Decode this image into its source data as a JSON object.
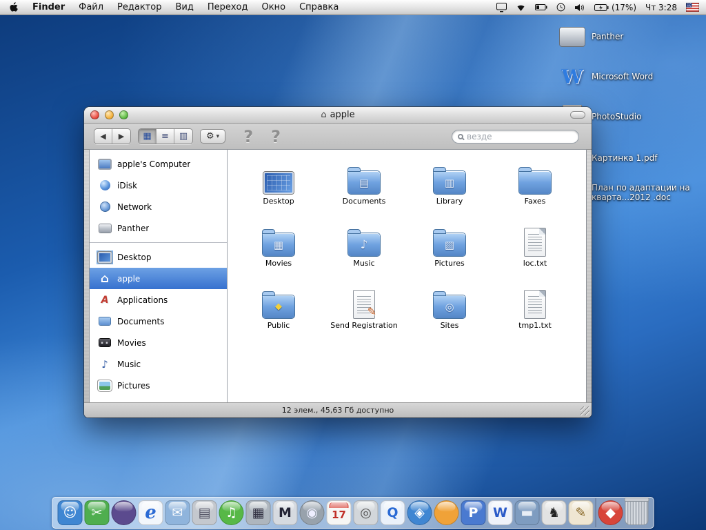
{
  "menubar": {
    "menus": [
      {
        "name": "menu-finder",
        "label": "Finder",
        "cls": "bold"
      },
      {
        "name": "menu-file",
        "label": "Файл"
      },
      {
        "name": "menu-edit",
        "label": "Редактор"
      },
      {
        "name": "menu-view",
        "label": "Вид"
      },
      {
        "name": "menu-go",
        "label": "Переход"
      },
      {
        "name": "menu-window",
        "label": "Окно"
      },
      {
        "name": "menu-help",
        "label": "Справка"
      }
    ],
    "status": {
      "battery": "(17%)",
      "clock": "Чт 3:28"
    }
  },
  "desktop": {
    "items": [
      {
        "id": "d1",
        "name": "desktop-volume-panther",
        "label": "Panther",
        "icon": "harddisk"
      },
      {
        "id": "d2",
        "name": "desktop-app-microsoft-word",
        "label": "Microsoft Word",
        "icon": "word"
      },
      {
        "id": "d3",
        "name": "desktop-app-photostudio",
        "label": "PhotoStudio",
        "icon": "app"
      },
      {
        "id": "d4",
        "name": "desktop-file-kartinka-pdf",
        "label": "Картинка 1.pdf",
        "icon": "pdf"
      },
      {
        "id": "d5",
        "name": "desktop-file-plan-doc",
        "label": "План по адаптации на кварта...2012 .doc",
        "icon": "doc"
      }
    ]
  },
  "window": {
    "title": "apple",
    "title_icon": "⌂",
    "toolbar": {
      "back": "◀",
      "forward": "▶",
      "view_grid": "▦",
      "view_list": "≡",
      "view_columns": "▥",
      "gear": "⚙",
      "menu_arrow": "▾",
      "ghost": "?"
    },
    "search": {
      "placeholder": "везде"
    },
    "sidebar": {
      "top": [
        {
          "name": "sidebar-apples-computer",
          "label": "apple's Computer",
          "icon": "computer"
        },
        {
          "name": "sidebar-idisk",
          "label": "iDisk",
          "icon": "idisk"
        },
        {
          "name": "sidebar-network",
          "label": "Network",
          "icon": "network"
        },
        {
          "name": "sidebar-panther",
          "label": "Panther",
          "icon": "disk"
        }
      ],
      "bottom": [
        {
          "name": "sidebar-desktop",
          "label": "Desktop",
          "icon": "desktop"
        },
        {
          "name": "sidebar-apple-home",
          "label": "apple",
          "icon": "home",
          "state": "selected"
        },
        {
          "name": "sidebar-applications",
          "label": "Applications",
          "icon": "applications"
        },
        {
          "name": "sidebar-documents",
          "label": "Documents",
          "icon": "folder"
        },
        {
          "name": "sidebar-movies",
          "label": "Movies",
          "icon": "movies"
        },
        {
          "name": "sidebar-music",
          "label": "Music",
          "icon": "music"
        },
        {
          "name": "sidebar-pictures",
          "label": "Pictures",
          "icon": "folder pictures"
        }
      ]
    },
    "files": [
      {
        "name": "desktop-item",
        "label": "Desktop",
        "icon": "screen"
      },
      {
        "name": "documents-folder",
        "label": "Documents",
        "icon": "folder docs"
      },
      {
        "name": "library-folder",
        "label": "Library",
        "icon": "folder library"
      },
      {
        "name": "faxes-folder",
        "label": "Faxes",
        "icon": "folder"
      },
      {
        "name": "movies-folder",
        "label": "Movies",
        "icon": "folder movies"
      },
      {
        "name": "music-folder",
        "label": "Music",
        "icon": "folder music"
      },
      {
        "name": "pictures-folder",
        "label": "Pictures",
        "icon": "folder pictures"
      },
      {
        "name": "loc-txt-file",
        "label": "loc.txt",
        "icon": "page"
      },
      {
        "name": "public-folder",
        "label": "Public",
        "icon": "folder public"
      },
      {
        "name": "send-registration-file",
        "label": "Send Registration",
        "icon": "page send"
      },
      {
        "name": "sites-folder",
        "label": "Sites",
        "icon": "folder sites"
      },
      {
        "name": "tmp1-txt-file",
        "label": "tmp1.txt",
        "icon": "page"
      }
    ],
    "status_text": "12 элем., 45,63 Гб доступно"
  },
  "dock": {
    "items": [
      {
        "name": "finder",
        "glyph": "☺",
        "bg": "#3f86d2",
        "fg": "#ffffff"
      },
      {
        "name": "app-green",
        "glyph": "✂",
        "bg": "#4fae4f",
        "fg": "#ffffff"
      },
      {
        "name": "app-purple",
        "glyph": "",
        "bg": "#5b4a8e",
        "fg": "#ffffff",
        "cls": "round"
      },
      {
        "name": "internet-explorer",
        "glyph": "e",
        "bg": "#f2f6fb",
        "fg": "#2a6ad4",
        "cls": "big-italic"
      },
      {
        "name": "mail",
        "glyph": "✉",
        "bg": "#8fb4dc",
        "fg": "#ffffff"
      },
      {
        "name": "printer",
        "glyph": "▤",
        "bg": "#c4c8ce",
        "fg": "#556"
      },
      {
        "name": "itunes",
        "glyph": "♫",
        "bg": "#57b847",
        "fg": "#ffffff",
        "cls": "round"
      },
      {
        "name": "calculator",
        "glyph": "▦",
        "bg": "#aeb6be",
        "fg": "#334"
      },
      {
        "name": "mplayer",
        "glyph": "M",
        "bg": "#d6dae0",
        "fg": "#223",
        "cls": "bold"
      },
      {
        "name": "dvd-player",
        "glyph": "◉",
        "bg": "#98a2ac",
        "fg": "#eef",
        "cls": "round"
      },
      {
        "name": "ical",
        "glyph": "17",
        "bg": "#f6f6f4",
        "fg": "#c03028",
        "cls": "cal bold"
      },
      {
        "name": "app-grey",
        "glyph": "◎",
        "bg": "#d2d6da",
        "fg": "#555"
      },
      {
        "name": "quicktime",
        "glyph": "Q",
        "bg": "#eaf1fa",
        "fg": "#2a6ad4",
        "cls": "bold"
      },
      {
        "name": "safari",
        "glyph": "◈",
        "bg": "#3f86d2",
        "fg": "#ffffff",
        "cls": "round"
      },
      {
        "name": "app-orange",
        "glyph": "",
        "bg": "#f0a238",
        "fg": "#fff8e0",
        "cls": "round"
      },
      {
        "name": "app-blue-p",
        "glyph": "P",
        "bg": "#4a7ad0",
        "fg": "#ffffff",
        "cls": "bold"
      },
      {
        "name": "microsoft-word",
        "glyph": "W",
        "bg": "#eef2fa",
        "fg": "#2a5ac8",
        "cls": "bold"
      },
      {
        "name": "folder-drawer",
        "glyph": "▬",
        "bg": "#7e9cc0",
        "fg": "#e8eef6"
      },
      {
        "name": "chess",
        "glyph": "♞",
        "bg": "#e2e2e2",
        "fg": "#222"
      },
      {
        "name": "art-app",
        "glyph": "✎",
        "bg": "#efe6d2",
        "fg": "#8a6a2a"
      },
      {
        "name": "dock-separator",
        "cls": "sep"
      },
      {
        "name": "app-red",
        "glyph": "◆",
        "bg": "#d8453a",
        "fg": "#ffffff",
        "cls": "round"
      },
      {
        "name": "trash",
        "cls": "trash"
      }
    ]
  }
}
